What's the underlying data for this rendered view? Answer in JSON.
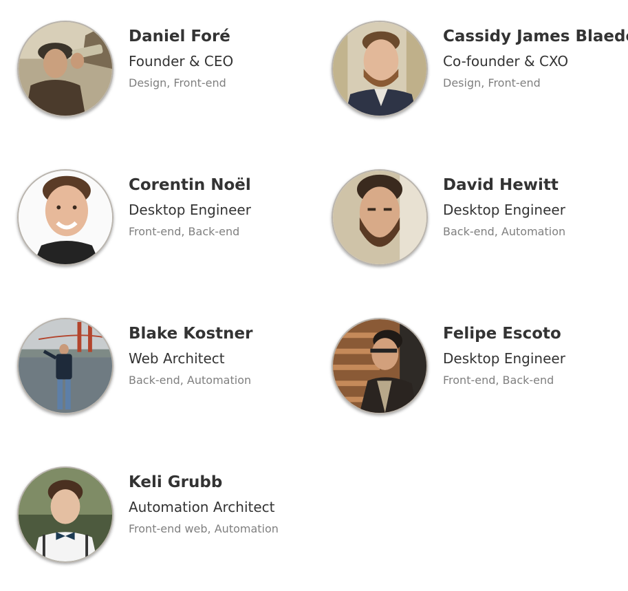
{
  "team": [
    {
      "name": "Daniel Foré",
      "role": "Founder & CEO",
      "skills": "Design, Front-end",
      "photo": "photo-of-daniel-fore"
    },
    {
      "name": "Cassidy James Blaede",
      "role": "Co-founder & CXO",
      "skills": "Design, Front-end",
      "photo": "photo-of-cassidy-james-blaede"
    },
    {
      "name": "Corentin Noël",
      "role": "Desktop Engineer",
      "skills": "Front-end, Back-end",
      "photo": "photo-of-corentin-noel"
    },
    {
      "name": "David Hewitt",
      "role": "Desktop Engineer",
      "skills": "Back-end, Automation",
      "photo": "photo-of-david-hewitt"
    },
    {
      "name": "Blake Kostner",
      "role": "Web Architect",
      "skills": "Back-end, Automation",
      "photo": "photo-of-blake-kostner"
    },
    {
      "name": "Felipe Escoto",
      "role": "Desktop Engineer",
      "skills": "Front-end, Back-end",
      "photo": "photo-of-felipe-escoto"
    },
    {
      "name": "Keli Grubb",
      "role": "Automation Architect",
      "skills": "Front-end web, Automation",
      "photo": "photo-of-keli-grubb"
    }
  ]
}
